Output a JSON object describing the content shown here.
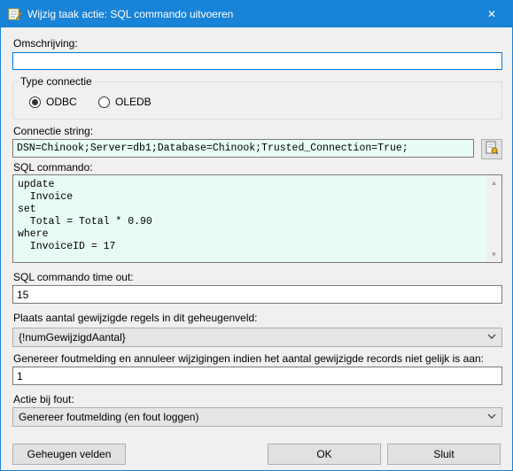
{
  "window": {
    "title": "Wijzig taak actie: SQL commando uitvoeren",
    "close_glyph": "✕"
  },
  "description": {
    "label": "Omschrijving:",
    "value": ""
  },
  "connection_type": {
    "label": "Type connectie",
    "options": [
      {
        "label": "ODBC",
        "selected": true
      },
      {
        "label": "OLEDB",
        "selected": false
      }
    ]
  },
  "connection_string": {
    "label": "Connectie string:",
    "value": "DSN=Chinook;Server=db1;Database=Chinook;Trusted_Connection=True;"
  },
  "sql_command": {
    "label": "SQL commando:",
    "value": "update\n  Invoice\nset\n  Total = Total * 0.90\nwhere\n  InvoiceID = 17"
  },
  "timeout": {
    "label": "SQL commando time out:",
    "value": "15"
  },
  "store_count": {
    "label": "Plaats aantal gewijzigde regels in dit geheugenveld:",
    "selected": "{!numGewijzigdAantal}"
  },
  "expected_count": {
    "label": "Genereer foutmelding en annuleer wijzigingen indien het aantal gewijzigde records niet gelijk is aan:",
    "value": "1"
  },
  "on_error": {
    "label": "Actie bij fout:",
    "selected": "Genereer foutmelding (en fout loggen)"
  },
  "buttons": {
    "memory_fields": "Geheugen velden",
    "ok": "OK",
    "close": "Sluit"
  },
  "colors": {
    "titlebar": "#1883d7",
    "sql_background": "#e8fcf4"
  }
}
